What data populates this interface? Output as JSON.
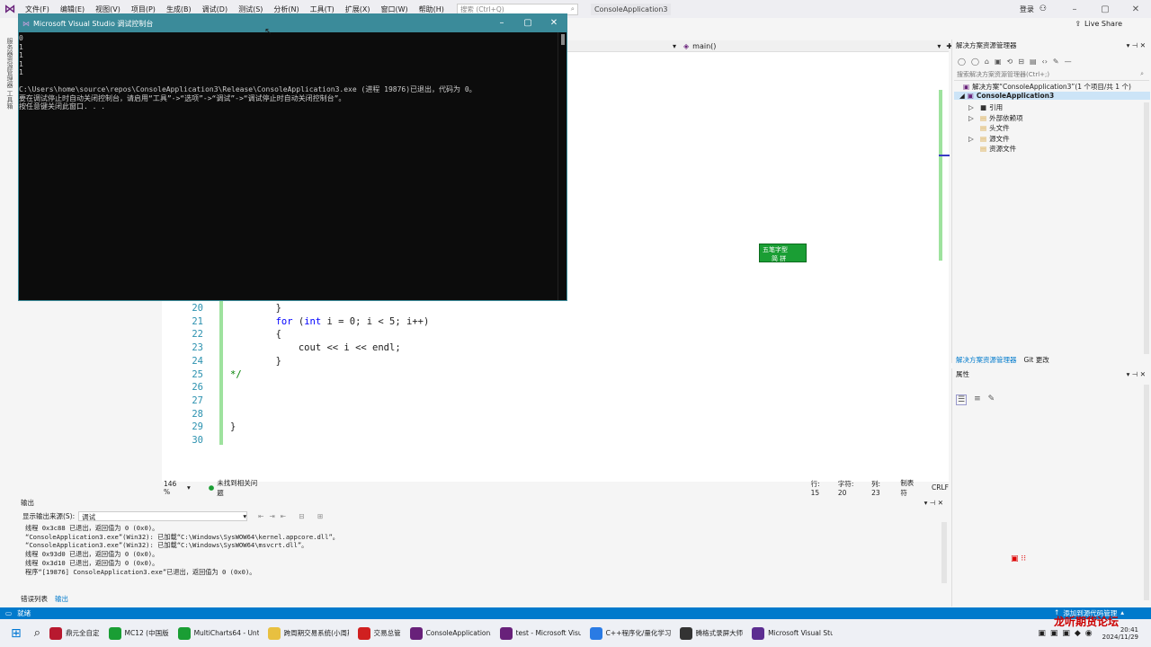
{
  "menu": {
    "items": [
      "文件(F)",
      "编辑(E)",
      "视图(V)",
      "项目(P)",
      "生成(B)",
      "调试(D)",
      "测试(S)",
      "分析(N)",
      "工具(T)",
      "扩展(X)",
      "窗口(W)",
      "帮助(H)"
    ],
    "search_placeholder": "搜索 (Ctrl+Q)",
    "solution_name": "ConsoleApplication3",
    "login": "登录",
    "live_share": "Live Share"
  },
  "left_strip": "服务器资源管理器 工具箱",
  "editor": {
    "function_dropdown": "main()",
    "lines": [
      {
        "num": "20",
        "code": "        }"
      },
      {
        "num": "21",
        "code": "        for (int i = 0; i < 5; i++)"
      },
      {
        "num": "22",
        "code": "        {"
      },
      {
        "num": "23",
        "code": "            cout << i << endl;"
      },
      {
        "num": "24",
        "code": "        }"
      },
      {
        "num": "25",
        "code": "*/"
      },
      {
        "num": "26",
        "code": ""
      },
      {
        "num": "27",
        "code": ""
      },
      {
        "num": "28",
        "code": ""
      },
      {
        "num": "29",
        "code": "}"
      },
      {
        "num": "30",
        "code": ""
      }
    ],
    "zoom": "146 %",
    "issues": "未找到相关问题",
    "row": "行: 15",
    "char": "字符: 20",
    "col": "列: 23",
    "tab": "制表符",
    "eol": "CRLF"
  },
  "console": {
    "title": "Microsoft Visual Studio 调试控制台",
    "lines": [
      "0",
      "1",
      "1",
      "1",
      "1",
      "",
      "C:\\Users\\home\\source\\repos\\ConsoleApplication3\\Release\\ConsoleApplication3.exe (进程 19876)已退出，代码为 0。",
      "要在调试停止时自动关闭控制台，请启用“工具”->“选项”->“调试”->“调试停止时自动关闭控制台”。",
      "按任意键关闭此窗口. . ."
    ]
  },
  "solution_explorer": {
    "title": "解决方案资源管理器",
    "search_placeholder": "搜索解决方案资源管理器(Ctrl+;)",
    "solution": "解决方案“ConsoleApplication3”(1 个项目/共 1 个)",
    "project": "ConsoleApplication3",
    "items": [
      "引用",
      "外部依赖项",
      "头文件",
      "源文件",
      "资源文件"
    ],
    "tabs": [
      "解决方案资源管理器",
      "Git 更改"
    ]
  },
  "properties": {
    "title": "属性"
  },
  "ime": {
    "line1": "五笔字型",
    "line2": "简 拼"
  },
  "output": {
    "title": "输出",
    "source_label": "显示输出来源(S):",
    "source_value": "调试",
    "lines": [
      "线程 0x3c88 已退出，返回值为 0 (0x0)。",
      "“ConsoleApplication3.exe”(Win32): 已加载“C:\\Windows\\SysWOW64\\kernel.appcore.dll”。",
      "“ConsoleApplication3.exe”(Win32): 已加载“C:\\Windows\\SysWOW64\\msvcrt.dll”。",
      "线程 0x93d0 已退出，返回值为 0 (0x0)。",
      "线程 0x3d10 已退出，返回值为 0 (0x0)。",
      "程序“[19876] ConsoleApplication3.exe”已退出，返回值为 0 (0x0)。"
    ],
    "bottom_tabs": [
      "错误列表",
      "输出"
    ]
  },
  "statusbar": {
    "left": "就绪",
    "right": "添加到源代码管理"
  },
  "taskbar": {
    "apps": [
      "鼎元全自定",
      "MC12 (中国版",
      "MultiCharts64 - Untitl",
      "跨周期交易系统(小周期",
      "交易总管",
      "ConsoleApplication3 -",
      "test - Microsoft Visual",
      "C++程序化/量化学习",
      "腾格式录屏大师",
      "Microsoft Visual Studi"
    ],
    "time": "20:41",
    "date": "2024/11/29",
    "watermark": "龙听期货论坛"
  },
  "colors": {
    "accent": "#007acc",
    "console_title": "#3b8b9a",
    "vs_purple": "#68217a"
  }
}
